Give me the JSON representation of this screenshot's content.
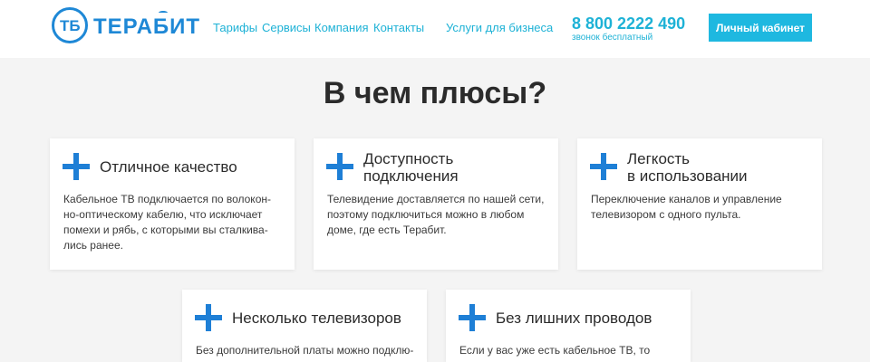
{
  "header": {
    "logo_text": "ТЕРАБИТ",
    "logo_mark": "ТБ",
    "nav": [
      "Тарифы",
      "Сервисы",
      "Компания",
      "Контакты"
    ],
    "business_link": "Услуги для бизнеса",
    "phone": "8 800 2222 490",
    "phone_note": "звонок бесплатный",
    "cabinet_button": "Личный кабинет"
  },
  "main": {
    "heading": "В чем плюсы?",
    "cards": [
      {
        "title_lines": [
          "Отличное качество"
        ],
        "text": "Кабельное ТВ подключается по волокон-но-оптическому кабелю, что исключает помехи и рябь, с которыми вы сталкива-лись ранее."
      },
      {
        "title_lines": [
          "Доступность",
          "подключения"
        ],
        "text": "Телевидение доставляется по нашей сети, поэтому подключиться можно в любом доме, где есть Терабит."
      },
      {
        "title_lines": [
          "Легкость",
          "в использовании"
        ],
        "text": "Переключение каналов и управление телевизором с одного пульта."
      },
      {
        "title_lines": [
          "Несколько телевизоров"
        ],
        "text": "Без дополнительной платы можно подклю-"
      },
      {
        "title_lines": [
          "Без лишних проводов"
        ],
        "text": "Если у вас уже есть кабельное ТВ, то тянуть"
      }
    ]
  },
  "colors": {
    "brand": "#1e88d6",
    "accent": "#1eb8e0",
    "plus_icon": "#1e7fd6"
  },
  "icons": [
    "logo-icon",
    "plus-icon"
  ]
}
